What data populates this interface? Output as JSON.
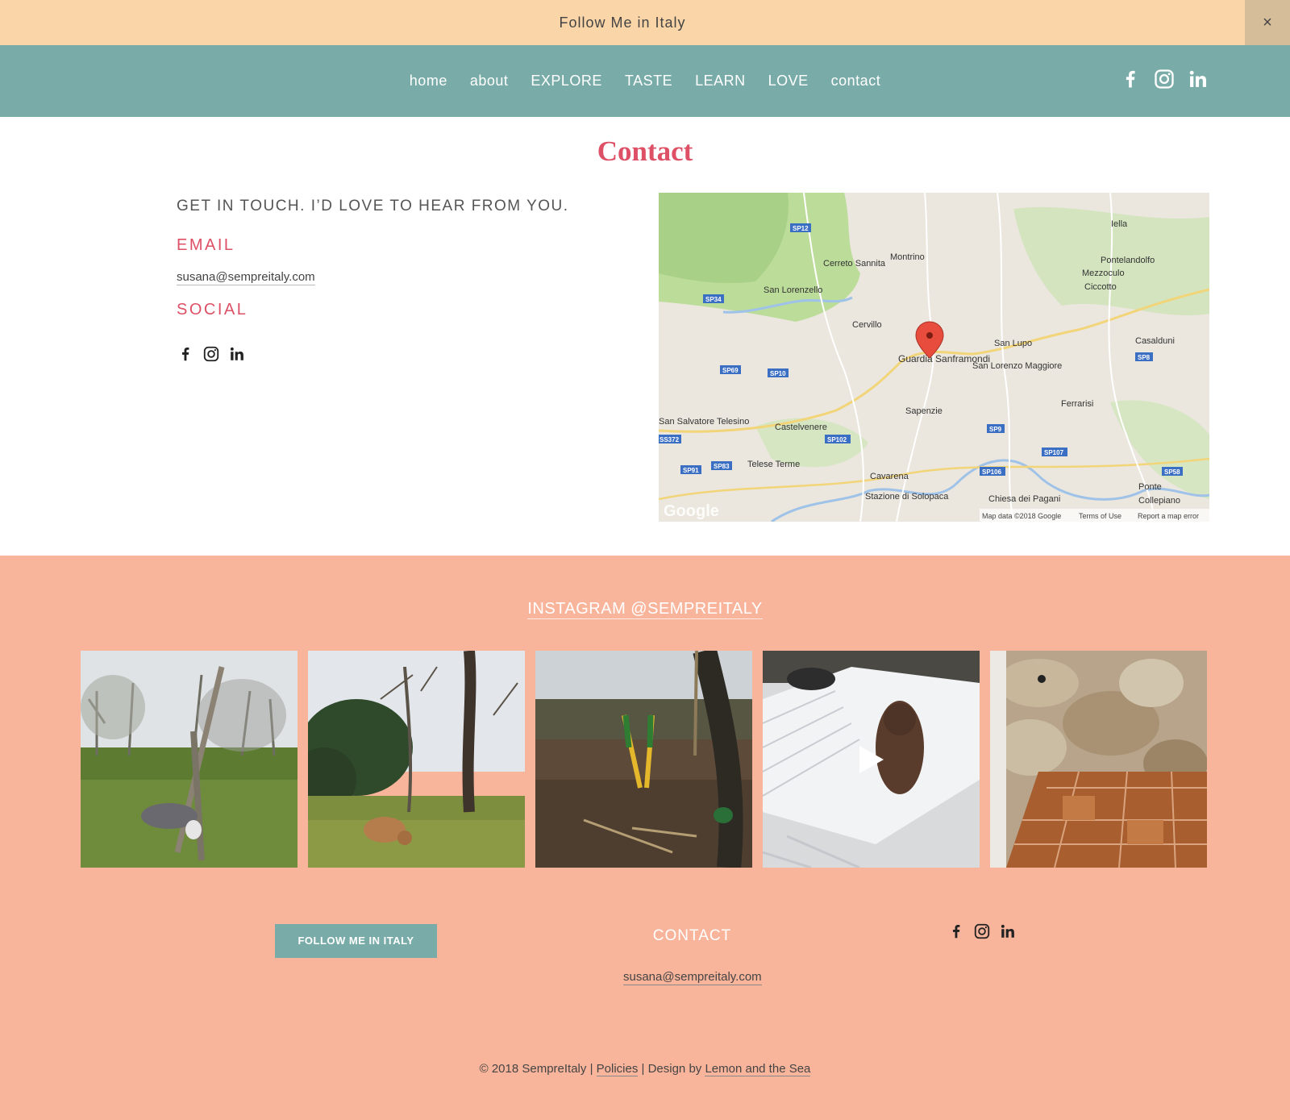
{
  "announcement": {
    "text": "Follow Me in Italy",
    "close_label": "×"
  },
  "nav": {
    "items": [
      "home",
      "about",
      "EXPLORE",
      "TASTE",
      "LEARN",
      "LOVE",
      "contact"
    ],
    "social_icons": [
      "facebook-icon",
      "instagram-icon",
      "linkedin-icon"
    ]
  },
  "contact": {
    "title": "Contact",
    "intro": "GET IN TOUCH. I’D LOVE TO HEAR FROM YOU.",
    "email_label": "EMAIL",
    "email": "susana@sempreitaly.com",
    "social_label": "SOCIAL"
  },
  "map": {
    "places": [
      "Iella",
      "Montrino",
      "Cerreto Sannita",
      "Pontelandolfo",
      "Mezzoculo",
      "Ciccotto",
      "San Lorenzello",
      "Cervillo",
      "San Lupo",
      "Casalduni",
      "Guardia Sanframondi",
      "San Lorenzo Maggiore",
      "Ferrarisi",
      "Sapenzie",
      "San Salvatore Telesino",
      "Castelvenere",
      "Telese Terme",
      "Cavarena",
      "Stazione di Solopaca",
      "Chiesa dei Pagani",
      "Ponte",
      "Collepiano"
    ],
    "road_labels": [
      "SP12",
      "SP34",
      "SP69",
      "SP10",
      "SP8",
      "SP9",
      "SP102",
      "SP107",
      "SS372",
      "SP91",
      "SP83",
      "SP106",
      "SP58"
    ],
    "attribution": "Map data ©2018 Google",
    "terms": "Terms of Use",
    "report": "Report a map error",
    "logo": "Google"
  },
  "footer": {
    "instagram_title": "INSTAGRAM @SEMPREITALY",
    "photos": [
      {
        "alt": "dog under olive tree"
      },
      {
        "alt": "dog in olive grove"
      },
      {
        "alt": "garden shears in field"
      },
      {
        "alt": "dogs in snow (video)"
      },
      {
        "alt": "stone wall and tiled floor"
      }
    ],
    "follow_button": "FOLLOW ME IN ITALY",
    "contact_label": "CONTACT",
    "email": "susana@sempreitaly.com",
    "copyright_prefix": "© 2018 SempreItaly",
    "policies": "Policies",
    "design_by": "Design by",
    "designer": "Lemon and the Sea",
    "separator": "|"
  },
  "colors": {
    "announcement_bg": "#fad5a7",
    "header_bg": "#79aca8",
    "accent": "#dd5065",
    "footer_bg": "#f9b59b"
  }
}
